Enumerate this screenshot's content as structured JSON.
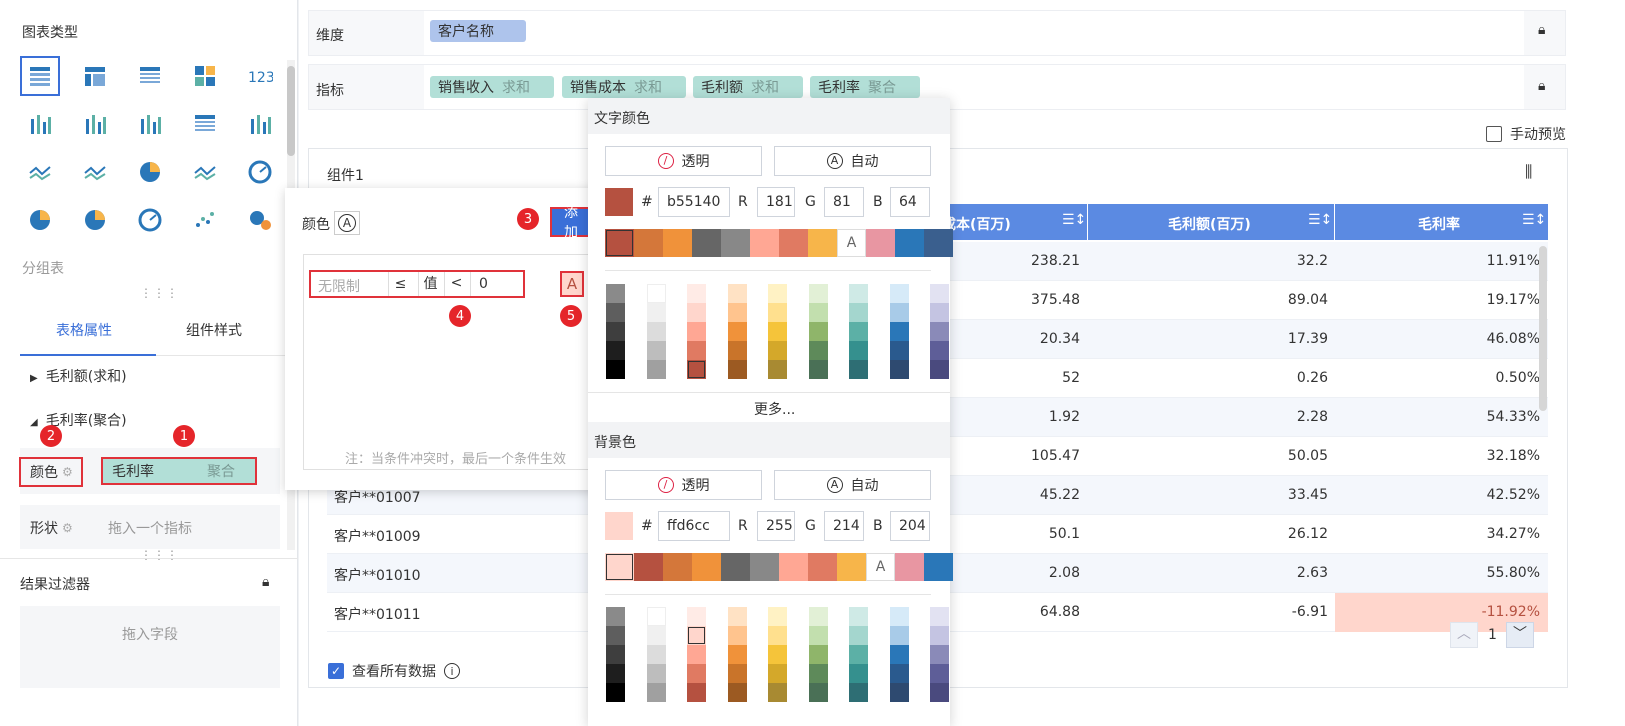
{
  "left": {
    "chart_type_title": "图表类型",
    "chart_types": [
      "table-icon",
      "crosstab-icon",
      "list-table-icon",
      "card-icon",
      "number-icon",
      "grouped-bar-icon",
      "column-icon",
      "stacked-column-icon",
      "bar-icon",
      "waterfall-icon",
      "line-icon",
      "radar-line-icon",
      "radar-icon",
      "area-icon",
      "gauge-icon",
      "pie-icon",
      "rose-icon",
      "ring-icon",
      "scatter-icon",
      "bubble-icon"
    ],
    "chart_type_caption": "分组表",
    "tabs": [
      "表格属性",
      "组件样式"
    ],
    "tree_item1": "毛利额(求和)",
    "tree_item2": "毛利率(聚合)",
    "color_label": "颜色",
    "color_pill_name": "毛利率",
    "color_pill_agg": "聚合",
    "shape_label": "形状",
    "shape_placeholder": "拖入一个指标",
    "filter_title": "结果过滤器",
    "filter_placeholder": "拖入字段"
  },
  "badges": [
    "1",
    "2",
    "3",
    "4",
    "5"
  ],
  "main": {
    "dimension_label": "维度",
    "dimension_pill": "客户名称",
    "metric_label": "指标",
    "metrics": [
      {
        "name": "销售收入",
        "agg": "求和"
      },
      {
        "name": "销售成本",
        "agg": "求和"
      },
      {
        "name": "毛利额",
        "agg": "求和"
      },
      {
        "name": "毛利率",
        "agg": "聚合"
      }
    ],
    "manual_preview": "手动预览",
    "component_title": "组件1",
    "view_all": "查看所有数据",
    "page_number": "1"
  },
  "table": {
    "headers": [
      "成本(百万)",
      "毛利额(百万)",
      "毛利率"
    ],
    "rows": [
      {
        "customer": "",
        "cost": "238.21",
        "profit": "32.2",
        "rate": "11.91%"
      },
      {
        "customer": "",
        "cost": "375.48",
        "profit": "89.04",
        "rate": "19.17%"
      },
      {
        "customer": "",
        "cost": "20.34",
        "profit": "17.39",
        "rate": "46.08%"
      },
      {
        "customer": "",
        "cost": "52",
        "profit": "0.26",
        "rate": "0.50%"
      },
      {
        "customer": "",
        "cost": "1.92",
        "profit": "2.28",
        "rate": "54.33%"
      },
      {
        "customer": "",
        "cost": "105.47",
        "profit": "50.05",
        "rate": "32.18%"
      },
      {
        "customer": "客户**01007",
        "cost": "45.22",
        "profit": "33.45",
        "rate": "42.52%"
      },
      {
        "customer": "客户**01009",
        "cost": "50.1",
        "profit": "26.12",
        "rate": "34.27%"
      },
      {
        "customer": "客户**01010",
        "cost": "2.08",
        "profit": "2.63",
        "rate": "55.80%"
      },
      {
        "customer": "客户**01011",
        "cost": "64.88",
        "profit": "-6.91",
        "rate": "-11.92%"
      }
    ]
  },
  "cond_dialog": {
    "color_label": "颜色",
    "add_button": "添加",
    "unlimited": "无限制",
    "op1": "≤",
    "value_label": "值",
    "op2": "<",
    "value": "0",
    "font_icon": "A",
    "note": "注：当条件冲突时，最后一个条件生效"
  },
  "color_picker": {
    "text_color_title": "文字颜色",
    "transparent": "透明",
    "auto": "自动",
    "hex_prefix": "#",
    "text": {
      "hex": "b55140",
      "r": "181",
      "g": "81",
      "b": "64",
      "preview": "#b55140"
    },
    "more": "更多...",
    "bg_color_title": "背景色",
    "bg": {
      "hex": "ffd6cc",
      "r": "255",
      "g": "214",
      "b": "204",
      "preview": "#ffd6cc"
    },
    "r_label": "R",
    "g_label": "G",
    "b_label": "B",
    "recent_text": [
      "#b55140",
      "#d4773a",
      "#f0923a",
      "#666666",
      "#888888",
      "#ffa794",
      "#e07a62",
      "#f7b54a",
      "A",
      "#e896a2",
      "#2a77b8",
      "#3a5f8e"
    ],
    "recent_bg": [
      "#ffd6cc",
      "#b55140",
      "#d4773a",
      "#f0923a",
      "#666666",
      "#888888",
      "#ffa794",
      "#e07a62",
      "#f7b54a",
      "A",
      "#e896a2",
      "#2a77b8"
    ],
    "palette": [
      [
        "#8a8a8a",
        "#5e5e5e",
        "#3e3e3e",
        "#1e1e1e",
        "#000000"
      ],
      [
        "#ffffff",
        "#f0f0f0",
        "#dcdcdc",
        "#bdbdbd",
        "#a0a0a0"
      ],
      [
        "#ffebe6",
        "#ffd6cc",
        "#ffa794",
        "#e07a62",
        "#b55140"
      ],
      [
        "#ffe2c4",
        "#ffc48e",
        "#f0923a",
        "#c9742a",
        "#9c5a22"
      ],
      [
        "#fff2c4",
        "#ffe08e",
        "#f5c43a",
        "#d4a82a",
        "#a88a32"
      ],
      [
        "#e2f0d6",
        "#c2dfae",
        "#8fb56a",
        "#5e8a5a",
        "#4a7056"
      ],
      [
        "#cfeae6",
        "#a4d6ce",
        "#5cb0a6",
        "#35908e",
        "#2e6e74"
      ],
      [
        "#d6eaf8",
        "#a8cbe8",
        "#2a77b8",
        "#2a5a8e",
        "#2e4a70"
      ],
      [
        "#e2e2f2",
        "#c4c4e2",
        "#8a8ab8",
        "#5e5e98",
        "#4a4a7e"
      ]
    ]
  }
}
